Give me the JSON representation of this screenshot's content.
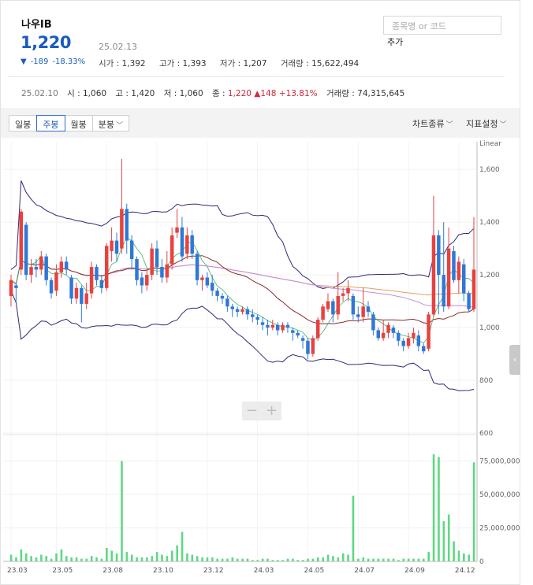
{
  "stock": {
    "name": "나우IB",
    "price": "1,220",
    "date": "25.02.13",
    "change_arrow": "▼",
    "change": "-189",
    "change_pct": "-18.33%",
    "open_label": "시가",
    "open": "1,392",
    "high_label": "고가",
    "high": "1,393",
    "low_label": "저가",
    "low": "1,207",
    "volume_label": "거래량",
    "volume": "15,622,494"
  },
  "search": {
    "placeholder": "종목명 or 코드",
    "add_label": "추가"
  },
  "daily": {
    "date": "25.02.10",
    "open_label": "시",
    "open": "1,060",
    "high_label": "고",
    "high": "1,420",
    "low_label": "저",
    "low": "1,060",
    "close_label": "종",
    "close": "1,220",
    "diff_arrow": "▲",
    "diff": "148",
    "diff_pct": "+13.81%",
    "volume_label": "거래량",
    "volume": "74,315,645"
  },
  "toolbar": {
    "tabs": [
      "일봉",
      "주봉",
      "월봉",
      "분봉"
    ],
    "active_tab": "주봉",
    "chart_type_label": "차트종류",
    "indicator_label": "지표설정"
  },
  "zoom": {
    "minus": "−",
    "plus": "+"
  },
  "colors": {
    "up": "#e8413e",
    "down": "#2f78d6",
    "volume": "#5fd884",
    "ma5": "#3cb371",
    "ma20": "#8b2b2b",
    "ma60": "#c78bdb",
    "ma120": "#e0a060",
    "band": "#2c2a7a",
    "accent": "#1a5bbf"
  },
  "chart_data": {
    "type": "candlestick",
    "scale": "Linear",
    "price_ticks": [
      600,
      800,
      1000,
      1200,
      1400,
      1600
    ],
    "price_tick_labels": [
      "600",
      "800",
      "1,000",
      "1,200",
      "1,400",
      "1,600"
    ],
    "ylim": [
      600,
      1720
    ],
    "volume_ticks": [
      0,
      25000000,
      50000000,
      75000000
    ],
    "volume_tick_labels": [
      "0",
      "25,000,000",
      "50,000,000",
      "75,000,000"
    ],
    "volume_ylim": [
      0,
      90000000
    ],
    "x_tick_labels": [
      {
        "label": "23.03",
        "index": 0
      },
      {
        "label": "23.05",
        "index": 9
      },
      {
        "label": "23.08",
        "index": 19
      },
      {
        "label": "23.10",
        "index": 29
      },
      {
        "label": "23.12",
        "index": 39
      },
      {
        "label": "24.03",
        "index": 49
      },
      {
        "label": "24.05",
        "index": 59
      },
      {
        "label": "24.07",
        "index": 69
      },
      {
        "label": "24.09",
        "index": 79
      },
      {
        "label": "24.12",
        "index": 89
      }
    ],
    "candles": [
      [
        1120,
        1180,
        1080,
        1200
      ],
      [
        1160,
        1150,
        1100,
        1170
      ],
      [
        1220,
        1440,
        1200,
        1450
      ],
      [
        1390,
        1200,
        1180,
        1400
      ],
      [
        1200,
        1230,
        1170,
        1260
      ],
      [
        1230,
        1220,
        1190,
        1260
      ],
      [
        1220,
        1270,
        1200,
        1290
      ],
      [
        1270,
        1180,
        1160,
        1280
      ],
      [
        1180,
        1130,
        1110,
        1190
      ],
      [
        1140,
        1210,
        1120,
        1240
      ],
      [
        1210,
        1250,
        1190,
        1270
      ],
      [
        1250,
        1220,
        1200,
        1270
      ],
      [
        1190,
        1110,
        1090,
        1200
      ],
      [
        1110,
        1150,
        1090,
        1170
      ],
      [
        1150,
        1090,
        1020,
        1160
      ],
      [
        1090,
        1130,
        1070,
        1170
      ],
      [
        1130,
        1230,
        1110,
        1250
      ],
      [
        1230,
        1180,
        1160,
        1240
      ],
      [
        1180,
        1150,
        1130,
        1200
      ],
      [
        1150,
        1310,
        1140,
        1320
      ],
      [
        1290,
        1330,
        1250,
        1380
      ],
      [
        1330,
        1280,
        1250,
        1360
      ],
      [
        1300,
        1450,
        1280,
        1640
      ],
      [
        1450,
        1330,
        1280,
        1470
      ],
      [
        1330,
        1260,
        1220,
        1350
      ],
      [
        1260,
        1180,
        1160,
        1270
      ],
      [
        1190,
        1160,
        1130,
        1210
      ],
      [
        1160,
        1200,
        1140,
        1220
      ],
      [
        1200,
        1300,
        1180,
        1320
      ],
      [
        1300,
        1230,
        1200,
        1330
      ],
      [
        1230,
        1190,
        1170,
        1260
      ],
      [
        1190,
        1240,
        1170,
        1290
      ],
      [
        1240,
        1350,
        1220,
        1380
      ],
      [
        1360,
        1380,
        1340,
        1450
      ],
      [
        1380,
        1270,
        1250,
        1420
      ],
      [
        1280,
        1350,
        1260,
        1380
      ],
      [
        1350,
        1280,
        1260,
        1370
      ],
      [
        1280,
        1180,
        1160,
        1290
      ],
      [
        1180,
        1190,
        1140,
        1200
      ],
      [
        1190,
        1160,
        1150,
        1210
      ],
      [
        1170,
        1140,
        1120,
        1200
      ],
      [
        1140,
        1120,
        1100,
        1150
      ],
      [
        1120,
        1110,
        1090,
        1130
      ],
      [
        1110,
        1080,
        1060,
        1120
      ],
      [
        1080,
        1070,
        1040,
        1090
      ],
      [
        1070,
        1060,
        1040,
        1080
      ],
      [
        1060,
        1070,
        1050,
        1080
      ],
      [
        1070,
        1050,
        1030,
        1080
      ],
      [
        1050,
        1040,
        1020,
        1070
      ],
      [
        1040,
        1030,
        1010,
        1050
      ],
      [
        1020,
        1010,
        990,
        1040
      ],
      [
        1010,
        1000,
        970,
        1030
      ],
      [
        1000,
        1010,
        990,
        1030
      ],
      [
        1010,
        990,
        970,
        1020
      ],
      [
        990,
        1010,
        980,
        1020
      ],
      [
        1010,
        1000,
        980,
        1020
      ],
      [
        990,
        980,
        950,
        1000
      ],
      [
        980,
        970,
        960,
        990
      ],
      [
        960,
        950,
        920,
        970
      ],
      [
        950,
        900,
        880,
        960
      ],
      [
        900,
        960,
        890,
        970
      ],
      [
        960,
        1030,
        950,
        1040
      ],
      [
        1030,
        1080,
        1020,
        1090
      ],
      [
        1070,
        1100,
        1060,
        1130
      ],
      [
        1100,
        1050,
        1020,
        1110
      ],
      [
        1050,
        1120,
        1030,
        1210
      ],
      [
        1120,
        1130,
        1100,
        1150
      ],
      [
        1130,
        1150,
        1100,
        1180
      ],
      [
        1120,
        1050,
        1030,
        1130
      ],
      [
        1050,
        1040,
        1020,
        1080
      ],
      [
        1040,
        1080,
        1020,
        1150
      ],
      [
        1080,
        1060,
        1040,
        1100
      ],
      [
        1050,
        990,
        970,
        1060
      ],
      [
        990,
        960,
        950,
        1000
      ],
      [
        960,
        980,
        950,
        1030
      ],
      [
        980,
        1010,
        960,
        1020
      ],
      [
        1000,
        980,
        960,
        1010
      ],
      [
        980,
        950,
        930,
        990
      ],
      [
        950,
        930,
        910,
        960
      ],
      [
        930,
        960,
        920,
        980
      ],
      [
        960,
        980,
        940,
        1000
      ],
      [
        970,
        930,
        910,
        990
      ],
      [
        930,
        910,
        900,
        940
      ],
      [
        920,
        1050,
        910,
        1060
      ],
      [
        1050,
        1350,
        1040,
        1500
      ],
      [
        1350,
        1200,
        1050,
        1370
      ],
      [
        1200,
        1080,
        1060,
        1400
      ],
      [
        1080,
        1300,
        1070,
        1380
      ],
      [
        1290,
        1180,
        1170,
        1310
      ],
      [
        1180,
        1250,
        1130,
        1270
      ],
      [
        1240,
        1130,
        1100,
        1260
      ],
      [
        1130,
        1070,
        1060,
        1140
      ],
      [
        1070,
        1220,
        1060,
        1420
      ]
    ],
    "volume_millions": [
      5,
      3,
      9,
      6,
      4,
      3,
      5,
      4,
      2,
      6,
      9,
      4,
      3,
      3,
      2,
      2,
      4,
      3,
      2,
      10,
      8,
      6,
      75,
      7,
      5,
      3,
      3,
      3,
      4,
      7,
      5,
      4,
      8,
      12,
      22,
      6,
      5,
      4,
      3,
      3,
      3,
      2,
      2,
      2,
      3,
      2,
      2,
      2,
      1,
      1,
      2,
      2,
      1,
      1,
      1,
      2,
      2,
      1,
      1,
      2,
      2,
      3,
      3,
      5,
      4,
      3,
      6,
      5,
      49,
      2,
      3,
      2,
      2,
      2,
      2,
      2,
      2,
      1,
      2,
      2,
      2,
      2,
      2,
      7,
      80,
      78,
      30,
      35,
      15,
      8,
      6,
      5,
      74
    ]
  }
}
